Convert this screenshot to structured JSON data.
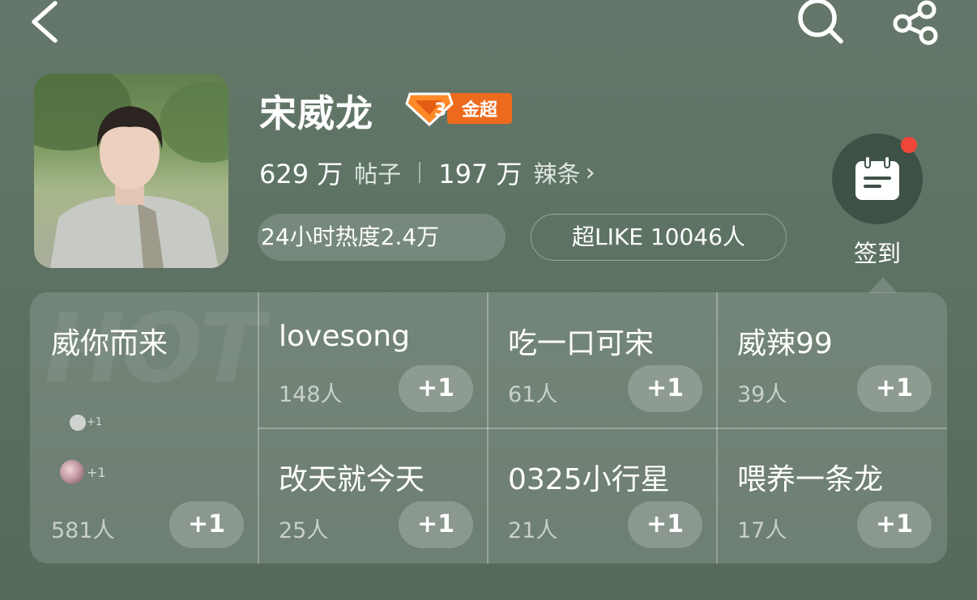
{
  "nav": {
    "back_icon": "chevron-left-icon",
    "search_icon": "search-icon",
    "share_icon": "share-icon"
  },
  "profile": {
    "name": "宋威龙",
    "level_badge": "3",
    "tier_label": "金超",
    "posts_count": "629 万",
    "posts_label": "帖子",
    "fans_count": "197 万",
    "fans_label": "辣条",
    "chevron": "›",
    "heat_label": "24小时热度2.4万",
    "like_label": "超LIKE 10046人"
  },
  "checkin": {
    "label": "签到",
    "icon": "calendar-icon",
    "has_notification": true
  },
  "hot_watermark": "HOT",
  "featured": {
    "name": "威你而来",
    "count": "581人",
    "button": "+1",
    "mini_plus_1": "+1",
    "mini_plus_2": "+1"
  },
  "groups": [
    {
      "name": "lovesong",
      "count": "148人",
      "button": "+1"
    },
    {
      "name": "吃一口可宋",
      "count": "61人",
      "button": "+1"
    },
    {
      "name": "威辣99",
      "count": "39人",
      "button": "+1"
    },
    {
      "name": "改天就今天",
      "count": "25人",
      "button": "+1"
    },
    {
      "name": "0325小行星",
      "count": "21人",
      "button": "+1"
    },
    {
      "name": "喂养一条龙",
      "count": "17人",
      "button": "+1"
    }
  ],
  "colors": {
    "accent": "#ee6a1e",
    "notification": "#f0473a",
    "background": "#5f7366"
  }
}
